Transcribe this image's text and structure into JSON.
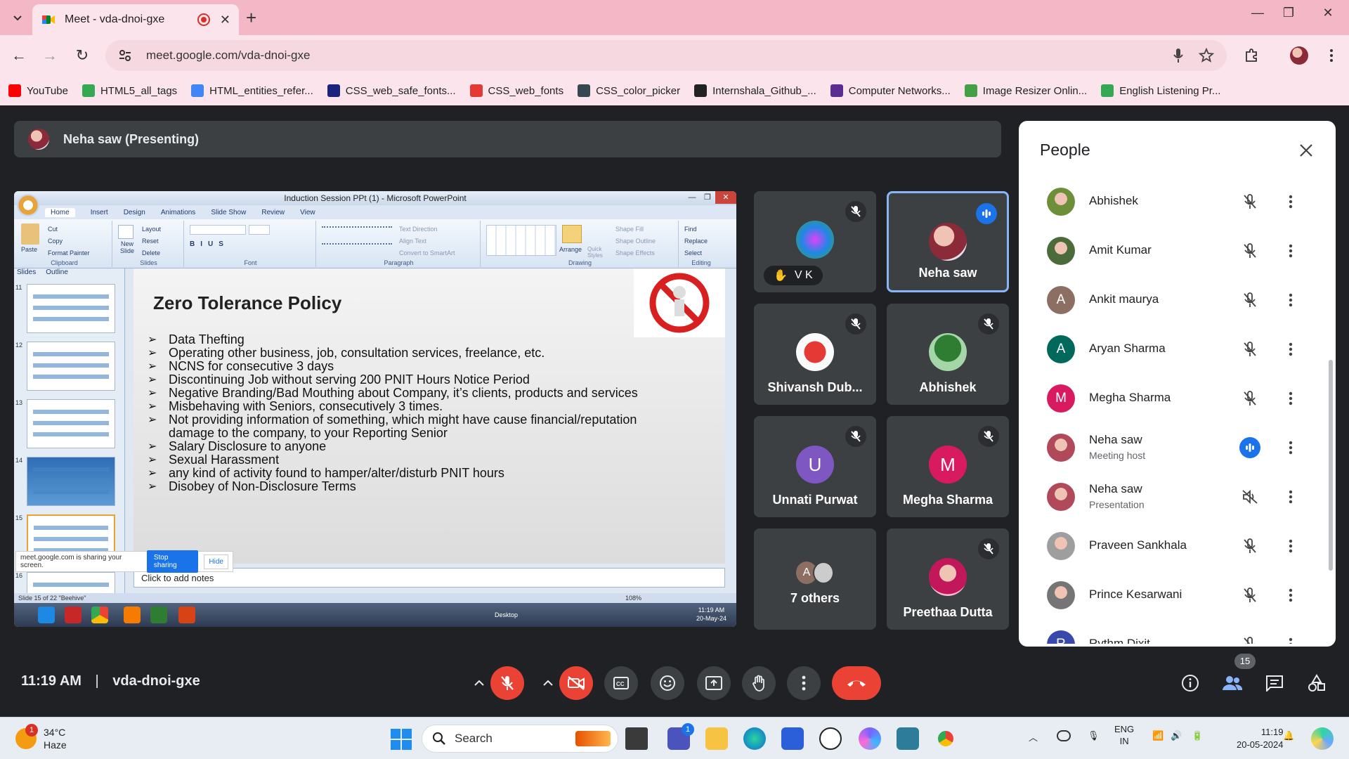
{
  "browser": {
    "tab_title": "Meet - vda-dnoi-gxe",
    "url": "meet.google.com/vda-dnoi-gxe",
    "bookmarks": [
      {
        "label": "YouTube",
        "color": "#ff0000"
      },
      {
        "label": "HTML5_all_tags",
        "color": "#34a853"
      },
      {
        "label": "HTML_entities_refer...",
        "color": "#4285f4"
      },
      {
        "label": "CSS_web_safe_fonts...",
        "color": "#1a237e"
      },
      {
        "label": "CSS_web_fonts",
        "color": "#e53935"
      },
      {
        "label": "CSS_color_picker",
        "color": "#37474f"
      },
      {
        "label": "Internshala_Github_...",
        "color": "#222222"
      },
      {
        "label": "Computer Networks...",
        "color": "#5c2d91"
      },
      {
        "label": "Image Resizer Onlin...",
        "color": "#43a047"
      },
      {
        "label": "English Listening Pr...",
        "color": "#34a853"
      }
    ]
  },
  "meet": {
    "presenter_label": "Neha saw (Presenting)",
    "time": "11:19 AM",
    "separator": "|",
    "code": "vda-dnoi-gxe",
    "participant_count": "15"
  },
  "shared_screen": {
    "window_title": "Induction Session PPt (1) - Microsoft PowerPoint",
    "menu": [
      "Home",
      "Insert",
      "Design",
      "Animations",
      "Slide Show",
      "Review",
      "View"
    ],
    "ribbon_groups": [
      "Clipboard",
      "Slides",
      "Font",
      "Paragraph",
      "Drawing",
      "Editing"
    ],
    "ribbon_items": {
      "clipboard": [
        "Cut",
        "Copy",
        "Format Painter"
      ],
      "paste": "Paste",
      "slides": [
        "Layout",
        "Reset",
        "Delete"
      ],
      "new_slide": "New Slide",
      "paragraph": [
        "Text Direction",
        "Align Text",
        "Convert to SmartArt"
      ],
      "arrange": "Arrange",
      "quick_styles": "Quick Styles",
      "drawing": [
        "Shape Fill",
        "Shape Outline",
        "Shape Effects"
      ],
      "editing": [
        "Find",
        "Replace",
        "Select"
      ]
    },
    "pane_tabs": [
      "Slides",
      "Outline"
    ],
    "thumb_numbers": [
      "11",
      "12",
      "13",
      "14",
      "15",
      "16"
    ],
    "slide_title": "Zero Tolerance Policy",
    "bullets": [
      "Data Thefting",
      "Operating other business, job, consultation services, freelance, etc.",
      "NCNS for consecutive 3 days",
      "Discontinuing Job without serving 200 PNIT Hours Notice Period",
      "Negative Branding/Bad Mouthing about Company, it’s clients, products and services",
      "Misbehaving with Seniors, consecutively 3 times.",
      "Not providing information of something, which might have cause financial/reputation damage to the company, to your Reporting Senior",
      "Salary Disclosure to anyone",
      "Sexual Harassment",
      "any kind of activity found to hamper/alter/disturb PNIT hours",
      "Disobey of Non-Disclosure Terms"
    ],
    "notes_placeholder": "Click to add notes",
    "share_banner": "meet.google.com is sharing your screen.",
    "stop_sharing": "Stop sharing",
    "hide": "Hide",
    "status": "Slide 15 of 22    \"Beehive\"",
    "zoom": "108%",
    "desktop_label": "Desktop",
    "clock_time": "11:19 AM",
    "clock_date": "20-May-24"
  },
  "tiles": [
    {
      "name": "V K",
      "color": "#3c4043"
    },
    {
      "name": "Neha saw",
      "color": "#3c4043"
    },
    {
      "name": "Shivansh Dub...",
      "color": "#3c4043"
    },
    {
      "name": "Abhishek",
      "color": "#3c4043"
    },
    {
      "name": "Unnati Purwat",
      "initial": "U",
      "color": "#7e57c2"
    },
    {
      "name": "Megha Sharma",
      "initial": "M",
      "color": "#d81b60"
    },
    {
      "name": "7 others",
      "initial": "A",
      "color": "#8d6e63"
    },
    {
      "name": "Preethaa Dutta",
      "color": "#3c4043"
    }
  ],
  "people": {
    "title": "People",
    "list": [
      {
        "name": "Abhishek",
        "role": "",
        "initial": "",
        "color": "#6d8f3a"
      },
      {
        "name": "Amit Kumar",
        "role": "",
        "initial": "",
        "color": "#4b6b3a"
      },
      {
        "name": "Ankit maurya",
        "role": "",
        "initial": "A",
        "color": "#8d6e63"
      },
      {
        "name": "Aryan Sharma",
        "role": "",
        "initial": "A",
        "color": "#00695c"
      },
      {
        "name": "Megha Sharma",
        "role": "",
        "initial": "M",
        "color": "#d81b60"
      },
      {
        "name": "Neha saw",
        "role": "Meeting host",
        "initial": "",
        "color": "#b04a5a"
      },
      {
        "name": "Neha saw",
        "role": "Presentation",
        "initial": "",
        "color": "#b04a5a"
      },
      {
        "name": "Praveen Sankhala",
        "role": "",
        "initial": "",
        "color": "#9e9e9e"
      },
      {
        "name": "Prince Kesarwani",
        "role": "",
        "initial": "",
        "color": "#757575"
      },
      {
        "name": "Rythm Dixit",
        "role": "",
        "initial": "R",
        "color": "#3949ab"
      }
    ]
  },
  "taskbar": {
    "weather_temp": "34°C",
    "weather_desc": "Haze",
    "weather_badge": "1",
    "search": "Search",
    "lang1": "ENG",
    "lang2": "IN",
    "time": "11:19",
    "date": "20-05-2024",
    "teams_badge": "1"
  },
  "colors": {
    "tabstrip": "#f4b7c6",
    "toolbar": "#fce4ec",
    "meet_bg": "#202124",
    "tile_bg": "#3c4043",
    "danger": "#ea4335",
    "accent": "#1a73e8"
  }
}
